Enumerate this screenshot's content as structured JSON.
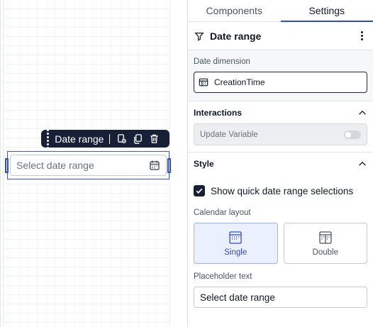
{
  "canvas": {
    "toolbar": {
      "title": "Date range",
      "icons": [
        "drag-handle-icon",
        "settings-copy-icon",
        "duplicate-icon",
        "delete-icon"
      ]
    },
    "widget": {
      "placeholder": "Select date range",
      "icon": "calendar-icon"
    }
  },
  "panel": {
    "tabs": [
      {
        "label": "Components",
        "active": false
      },
      {
        "label": "Settings",
        "active": true
      }
    ],
    "header": {
      "title": "Date range",
      "icon": "filter-icon",
      "menu_icon": "kebab-menu-icon"
    },
    "date_dimension": {
      "label": "Date dimension",
      "value": "CreationTime",
      "icon": "table-icon"
    },
    "interactions": {
      "title": "Interactions",
      "update_variable_label": "Update Variable",
      "update_variable_on": false
    },
    "style": {
      "title": "Style",
      "quick_ranges_label": "Show quick date range selections",
      "quick_ranges_checked": true,
      "calendar_layout_label": "Calendar layout",
      "layout_options": [
        {
          "label": "Single",
          "selected": true
        },
        {
          "label": "Double",
          "selected": false
        }
      ],
      "placeholder_label": "Placeholder text",
      "placeholder_value": "Select date range"
    }
  },
  "colors": {
    "accent": "#2f4bd6",
    "toolbar_bg": "#172036",
    "selected_option_bg": "#eaf0fd"
  }
}
